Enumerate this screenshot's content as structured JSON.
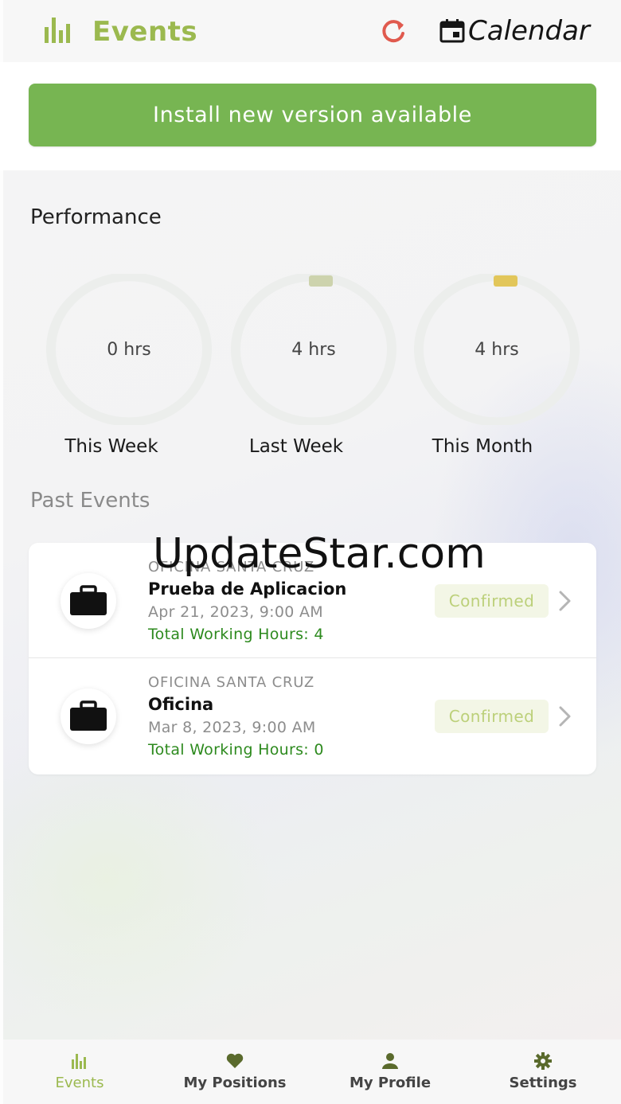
{
  "header": {
    "title": "Events",
    "calendar_label": "Calendar",
    "logo_icon": "bar-chart-icon",
    "refresh_icon": "refresh-icon",
    "calendar_icon": "calendar-icon"
  },
  "banner": {
    "install_label": "Install new version available"
  },
  "performance": {
    "title": "Performance",
    "rings": [
      {
        "value": "0 hrs",
        "label": "This Week",
        "progress": 0,
        "accent": "#e6e8e4"
      },
      {
        "value": "4 hrs",
        "label": "Last Week",
        "progress": 0.03,
        "accent": "#cdd3ad"
      },
      {
        "value": "4 hrs",
        "label": "This Month",
        "progress": 0.03,
        "accent": "#e2c65a"
      }
    ]
  },
  "past_events": {
    "title": "Past Events",
    "items": [
      {
        "location": "OFICINA SANTA CRUZ",
        "name": "Prueba de Aplicacion",
        "date": "Apr 21, 2023, 9:00 AM",
        "hours": "Total Working Hours: 4",
        "status": "Confirmed"
      },
      {
        "location": "OFICINA SANTA CRUZ",
        "name": "Oficina",
        "date": "Mar 8, 2023, 9:00 AM",
        "hours": "Total Working Hours: 0",
        "status": "Confirmed"
      }
    ]
  },
  "watermark": "UpdateStar.com",
  "nav": {
    "items": [
      {
        "label": "Events",
        "icon": "bar-chart-icon",
        "active": true
      },
      {
        "label": "My Positions",
        "icon": "heart-icon",
        "active": false
      },
      {
        "label": "My Profile",
        "icon": "person-icon",
        "active": false
      },
      {
        "label": "Settings",
        "icon": "gear-icon",
        "active": false
      }
    ]
  },
  "colors": {
    "brand_green": "#9bb94f",
    "install_green": "#77b552",
    "refresh_red": "#e05a4e",
    "hours_green": "#2d8a1e"
  }
}
